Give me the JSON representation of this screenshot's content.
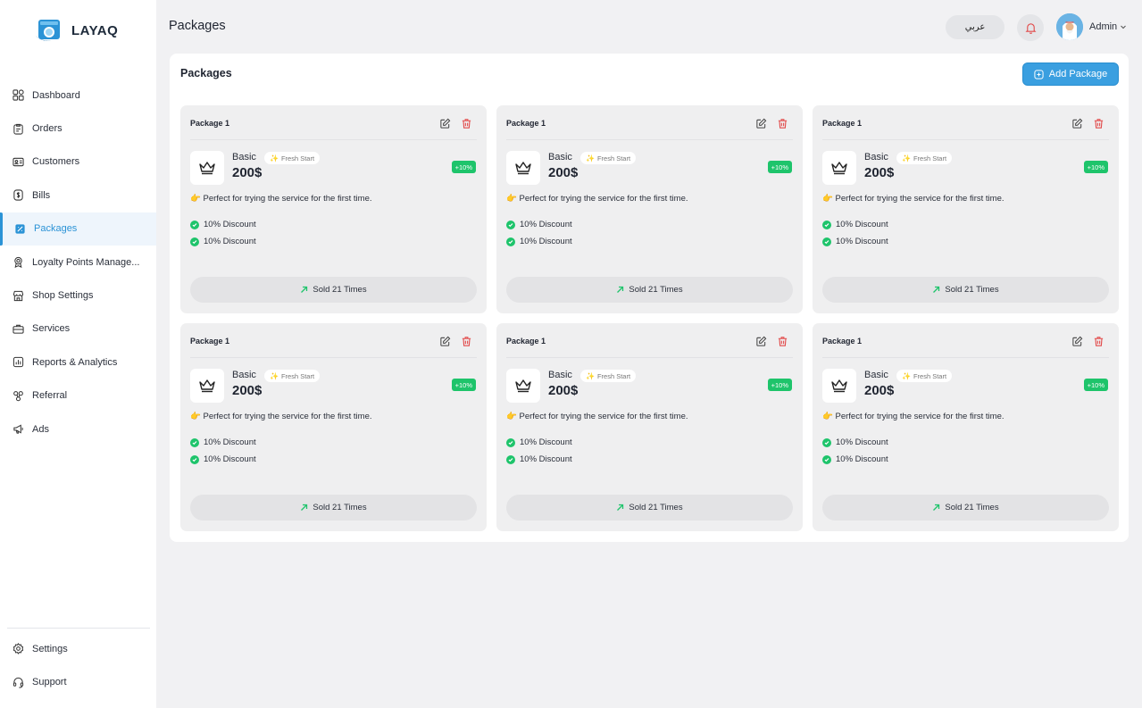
{
  "app": {
    "name": "LAYAQ"
  },
  "sidebar": {
    "items": [
      {
        "label": "Dashboard",
        "icon": "grid-icon"
      },
      {
        "label": "Orders",
        "icon": "clipboard-icon"
      },
      {
        "label": "Customers",
        "icon": "id-card-icon"
      },
      {
        "label": "Bills",
        "icon": "dollar-icon"
      },
      {
        "label": "Packages",
        "icon": "package-icon",
        "active": true
      },
      {
        "label": "Loyalty Points Manage...",
        "icon": "award-icon"
      },
      {
        "label": "Shop Settings",
        "icon": "shop-icon"
      },
      {
        "label": "Services",
        "icon": "briefcase-icon"
      },
      {
        "label": "Reports & Analytics",
        "icon": "chart-icon"
      },
      {
        "label": "Referral",
        "icon": "referral-icon"
      },
      {
        "label": "Ads",
        "icon": "megaphone-icon"
      }
    ],
    "bottom": [
      {
        "label": "Settings",
        "icon": "gear-icon"
      },
      {
        "label": "Support",
        "icon": "headset-icon"
      }
    ]
  },
  "header": {
    "title": "Packages",
    "language_button": "عربي",
    "user_name": "Admin"
  },
  "panel": {
    "title": "Packages",
    "add_button": "Add Package"
  },
  "colors": {
    "accent": "#3a9fe0",
    "active_nav": "#2b93d6",
    "success": "#1ec46b",
    "danger": "#e24b4b"
  },
  "cards": [
    {
      "name": "Package 1",
      "tier": "Basic",
      "tag": "Fresh Start",
      "price": "200$",
      "badge": "+10%",
      "description": "Perfect for trying the service for the first time.",
      "features": [
        "10% Discount",
        "10% Discount"
      ],
      "sold": "Sold 21 Times"
    },
    {
      "name": "Package 1",
      "tier": "Basic",
      "tag": "Fresh Start",
      "price": "200$",
      "badge": "+10%",
      "description": "Perfect for trying the service for the first time.",
      "features": [
        "10% Discount",
        "10% Discount"
      ],
      "sold": "Sold 21 Times"
    },
    {
      "name": "Package 1",
      "tier": "Basic",
      "tag": "Fresh Start",
      "price": "200$",
      "badge": "+10%",
      "description": "Perfect for trying the service for the first time.",
      "features": [
        "10% Discount",
        "10% Discount"
      ],
      "sold": "Sold 21 Times"
    },
    {
      "name": "Package 1",
      "tier": "Basic",
      "tag": "Fresh Start",
      "price": "200$",
      "badge": "+10%",
      "description": "Perfect for trying the service for the first time.",
      "features": [
        "10% Discount",
        "10% Discount"
      ],
      "sold": "Sold 21 Times"
    },
    {
      "name": "Package 1",
      "tier": "Basic",
      "tag": "Fresh Start",
      "price": "200$",
      "badge": "+10%",
      "description": "Perfect for trying the service for the first time.",
      "features": [
        "10% Discount",
        "10% Discount"
      ],
      "sold": "Sold 21 Times"
    },
    {
      "name": "Package 1",
      "tier": "Basic",
      "tag": "Fresh Start",
      "price": "200$",
      "badge": "+10%",
      "description": "Perfect for trying the service for the first time.",
      "features": [
        "10% Discount",
        "10% Discount"
      ],
      "sold": "Sold 21 Times"
    }
  ]
}
